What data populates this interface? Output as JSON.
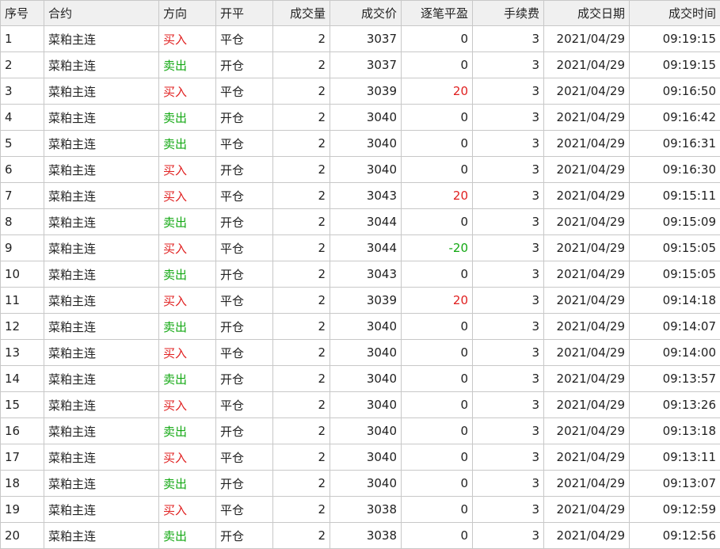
{
  "columns": [
    "序号",
    "合约",
    "方向",
    "开平",
    "成交量",
    "成交价",
    "逐笔平盈",
    "手续费",
    "成交日期",
    "成交时间"
  ],
  "colors": {
    "buy": "#e02020",
    "sell": "#13a813",
    "profit": "#e02020",
    "loss": "#13a813"
  },
  "rows": [
    {
      "no": "1",
      "contract": "菜粕主连",
      "direction": "买入",
      "offset": "平仓",
      "volume": "2",
      "price": "3037",
      "pnl": "0",
      "fee": "3",
      "date": "2021/04/29",
      "time": "09:19:15"
    },
    {
      "no": "2",
      "contract": "菜粕主连",
      "direction": "卖出",
      "offset": "开仓",
      "volume": "2",
      "price": "3037",
      "pnl": "0",
      "fee": "3",
      "date": "2021/04/29",
      "time": "09:19:15"
    },
    {
      "no": "3",
      "contract": "菜粕主连",
      "direction": "买入",
      "offset": "平仓",
      "volume": "2",
      "price": "3039",
      "pnl": "20",
      "fee": "3",
      "date": "2021/04/29",
      "time": "09:16:50"
    },
    {
      "no": "4",
      "contract": "菜粕主连",
      "direction": "卖出",
      "offset": "开仓",
      "volume": "2",
      "price": "3040",
      "pnl": "0",
      "fee": "3",
      "date": "2021/04/29",
      "time": "09:16:42"
    },
    {
      "no": "5",
      "contract": "菜粕主连",
      "direction": "卖出",
      "offset": "平仓",
      "volume": "2",
      "price": "3040",
      "pnl": "0",
      "fee": "3",
      "date": "2021/04/29",
      "time": "09:16:31"
    },
    {
      "no": "6",
      "contract": "菜粕主连",
      "direction": "买入",
      "offset": "开仓",
      "volume": "2",
      "price": "3040",
      "pnl": "0",
      "fee": "3",
      "date": "2021/04/29",
      "time": "09:16:30"
    },
    {
      "no": "7",
      "contract": "菜粕主连",
      "direction": "买入",
      "offset": "平仓",
      "volume": "2",
      "price": "3043",
      "pnl": "20",
      "fee": "3",
      "date": "2021/04/29",
      "time": "09:15:11"
    },
    {
      "no": "8",
      "contract": "菜粕主连",
      "direction": "卖出",
      "offset": "开仓",
      "volume": "2",
      "price": "3044",
      "pnl": "0",
      "fee": "3",
      "date": "2021/04/29",
      "time": "09:15:09"
    },
    {
      "no": "9",
      "contract": "菜粕主连",
      "direction": "买入",
      "offset": "平仓",
      "volume": "2",
      "price": "3044",
      "pnl": "-20",
      "fee": "3",
      "date": "2021/04/29",
      "time": "09:15:05"
    },
    {
      "no": "10",
      "contract": "菜粕主连",
      "direction": "卖出",
      "offset": "开仓",
      "volume": "2",
      "price": "3043",
      "pnl": "0",
      "fee": "3",
      "date": "2021/04/29",
      "time": "09:15:05"
    },
    {
      "no": "11",
      "contract": "菜粕主连",
      "direction": "买入",
      "offset": "平仓",
      "volume": "2",
      "price": "3039",
      "pnl": "20",
      "fee": "3",
      "date": "2021/04/29",
      "time": "09:14:18"
    },
    {
      "no": "12",
      "contract": "菜粕主连",
      "direction": "卖出",
      "offset": "开仓",
      "volume": "2",
      "price": "3040",
      "pnl": "0",
      "fee": "3",
      "date": "2021/04/29",
      "time": "09:14:07"
    },
    {
      "no": "13",
      "contract": "菜粕主连",
      "direction": "买入",
      "offset": "平仓",
      "volume": "2",
      "price": "3040",
      "pnl": "0",
      "fee": "3",
      "date": "2021/04/29",
      "time": "09:14:00"
    },
    {
      "no": "14",
      "contract": "菜粕主连",
      "direction": "卖出",
      "offset": "开仓",
      "volume": "2",
      "price": "3040",
      "pnl": "0",
      "fee": "3",
      "date": "2021/04/29",
      "time": "09:13:57"
    },
    {
      "no": "15",
      "contract": "菜粕主连",
      "direction": "买入",
      "offset": "平仓",
      "volume": "2",
      "price": "3040",
      "pnl": "0",
      "fee": "3",
      "date": "2021/04/29",
      "time": "09:13:26"
    },
    {
      "no": "16",
      "contract": "菜粕主连",
      "direction": "卖出",
      "offset": "开仓",
      "volume": "2",
      "price": "3040",
      "pnl": "0",
      "fee": "3",
      "date": "2021/04/29",
      "time": "09:13:18"
    },
    {
      "no": "17",
      "contract": "菜粕主连",
      "direction": "买入",
      "offset": "平仓",
      "volume": "2",
      "price": "3040",
      "pnl": "0",
      "fee": "3",
      "date": "2021/04/29",
      "time": "09:13:11"
    },
    {
      "no": "18",
      "contract": "菜粕主连",
      "direction": "卖出",
      "offset": "开仓",
      "volume": "2",
      "price": "3040",
      "pnl": "0",
      "fee": "3",
      "date": "2021/04/29",
      "time": "09:13:07"
    },
    {
      "no": "19",
      "contract": "菜粕主连",
      "direction": "买入",
      "offset": "平仓",
      "volume": "2",
      "price": "3038",
      "pnl": "0",
      "fee": "3",
      "date": "2021/04/29",
      "time": "09:12:59"
    },
    {
      "no": "20",
      "contract": "菜粕主连",
      "direction": "卖出",
      "offset": "开仓",
      "volume": "2",
      "price": "3038",
      "pnl": "0",
      "fee": "3",
      "date": "2021/04/29",
      "time": "09:12:56"
    }
  ]
}
